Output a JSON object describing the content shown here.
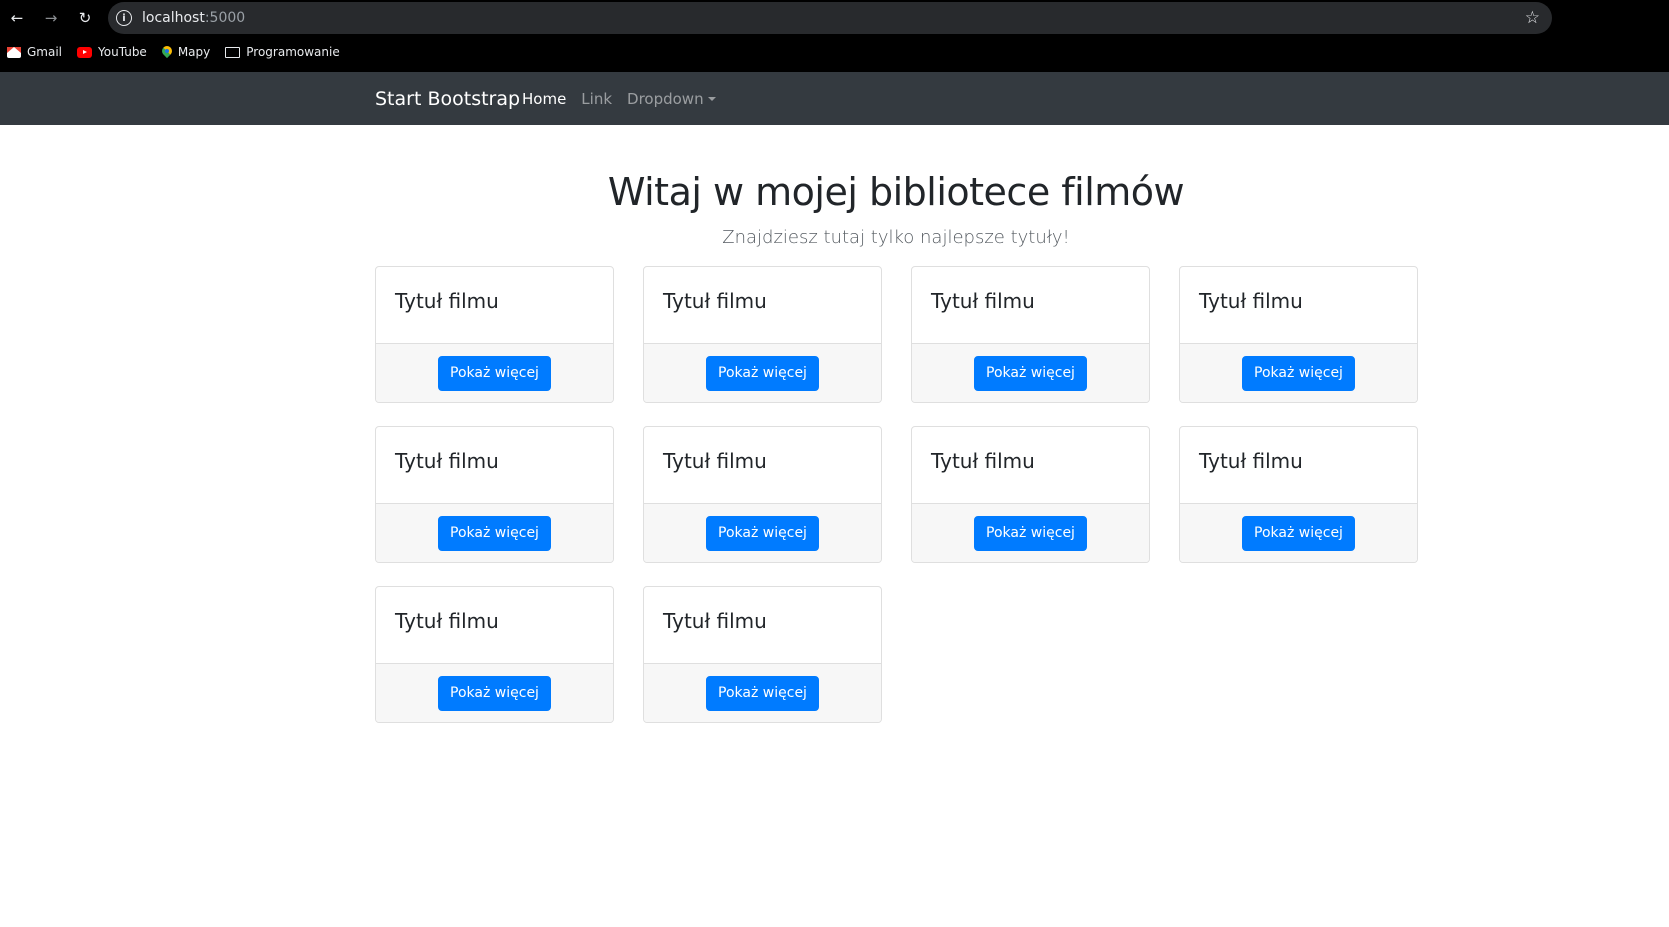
{
  "browser": {
    "url_host": "localhost",
    "url_port": ":5000",
    "bookmarks": [
      {
        "label": "Gmail",
        "icon": "gmail-icon"
      },
      {
        "label": "YouTube",
        "icon": "youtube-icon"
      },
      {
        "label": "Mapy",
        "icon": "maps-icon"
      },
      {
        "label": "Programowanie",
        "icon": "folder-icon"
      }
    ]
  },
  "navbar": {
    "brand": "Start Bootstrap",
    "links": [
      {
        "label": "Home"
      },
      {
        "label": "Link"
      },
      {
        "label": "Dropdown"
      }
    ]
  },
  "header": {
    "title": "Witaj w mojej bibliotece filmów",
    "lead": "Znajdziesz tutaj tylko najlepsze tytuły!"
  },
  "cards": [
    {
      "title": "Tytuł filmu",
      "button": "Pokaż więcej"
    },
    {
      "title": "Tytuł filmu",
      "button": "Pokaż więcej"
    },
    {
      "title": "Tytuł filmu",
      "button": "Pokaż więcej"
    },
    {
      "title": "Tytuł filmu",
      "button": "Pokaż więcej"
    },
    {
      "title": "Tytuł filmu",
      "button": "Pokaż więcej"
    },
    {
      "title": "Tytuł filmu",
      "button": "Pokaż więcej"
    },
    {
      "title": "Tytuł filmu",
      "button": "Pokaż więcej"
    },
    {
      "title": "Tytuł filmu",
      "button": "Pokaż więcej"
    },
    {
      "title": "Tytuł filmu",
      "button": "Pokaż więcej"
    },
    {
      "title": "Tytuł filmu",
      "button": "Pokaż więcej"
    }
  ],
  "colors": {
    "navbar_bg": "#343a40",
    "primary": "#007bff",
    "card_footer_bg": "#f7f7f7"
  }
}
